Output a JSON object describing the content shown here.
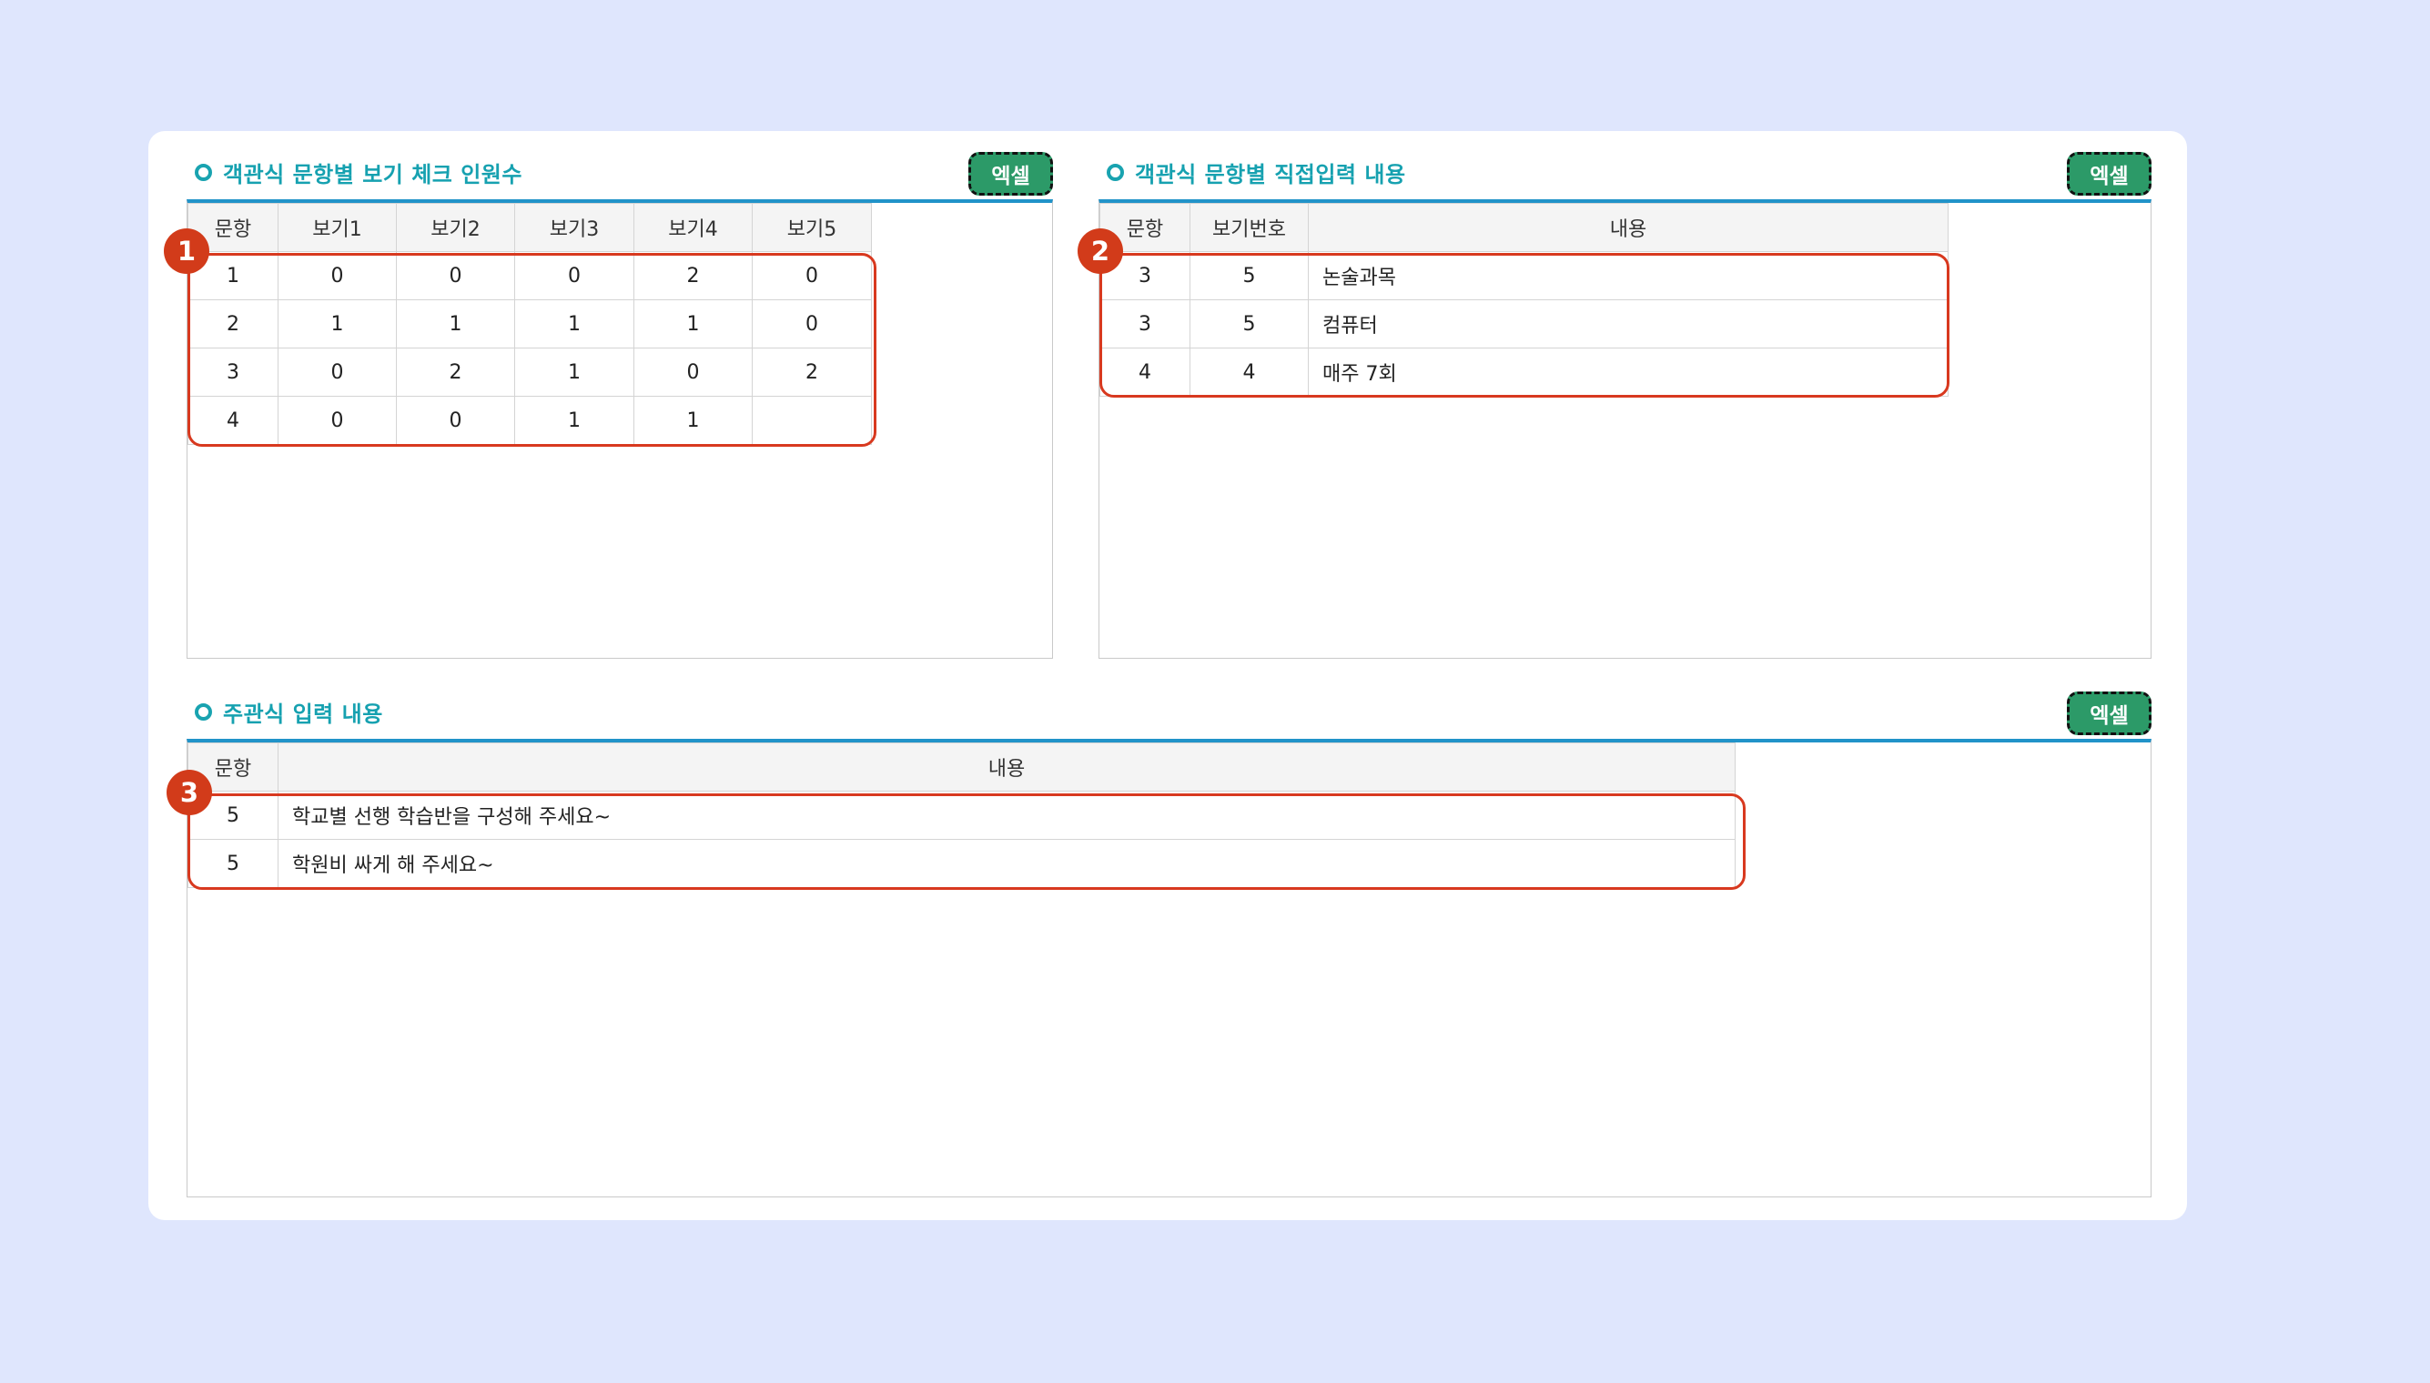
{
  "panels": {
    "choice_counts": {
      "title": "객관식 문항별 보기 체크 인원수",
      "excel_label": "엑셀",
      "headers": [
        "문항",
        "보기1",
        "보기2",
        "보기3",
        "보기4",
        "보기5"
      ],
      "rows": [
        [
          "1",
          "0",
          "0",
          "0",
          "2",
          "0"
        ],
        [
          "2",
          "1",
          "1",
          "1",
          "1",
          "0"
        ],
        [
          "3",
          "0",
          "2",
          "1",
          "0",
          "2"
        ],
        [
          "4",
          "0",
          "0",
          "1",
          "1",
          ""
        ]
      ]
    },
    "direct_input": {
      "title": "객관식 문항별 직접입력 내용",
      "excel_label": "엑셀",
      "headers": [
        "문항",
        "보기번호",
        "내용"
      ],
      "rows": [
        [
          "3",
          "5",
          "논술과목"
        ],
        [
          "3",
          "5",
          "컴퓨터"
        ],
        [
          "4",
          "4",
          "매주 7회"
        ]
      ]
    },
    "subjective": {
      "title": "주관식 입력 내용",
      "excel_label": "엑셀",
      "headers": [
        "문항",
        "내용"
      ],
      "rows": [
        [
          "5",
          "학교별 선행 학습반을 구성해 주세요~"
        ],
        [
          "5",
          "학원비 싸게 해 주세요~"
        ]
      ]
    }
  },
  "annotations": [
    "1",
    "2",
    "3"
  ],
  "colors": {
    "background": "#dfe6fd",
    "title_teal": "#16a1b0",
    "excel_green": "#2c9a68",
    "header_rule_blue": "#2193c9",
    "highlight_red": "#d8391f"
  }
}
